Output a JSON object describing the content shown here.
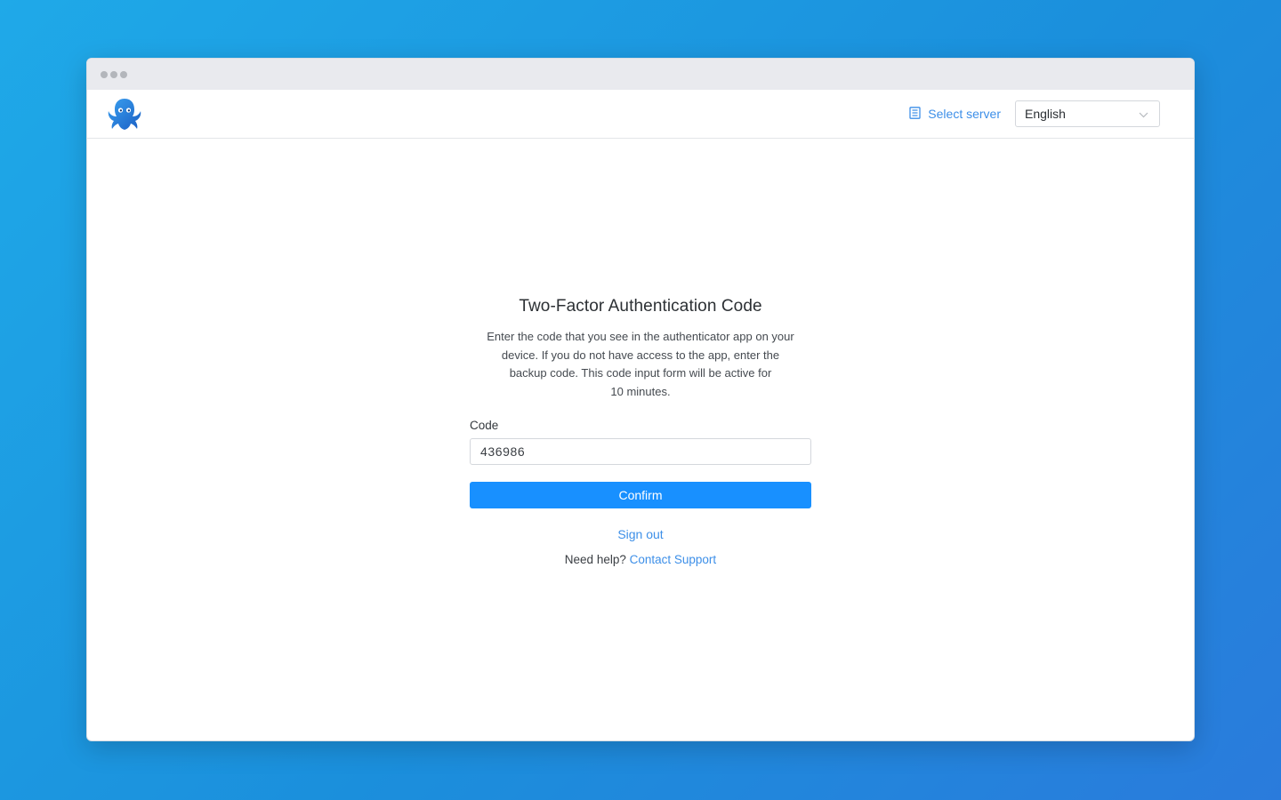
{
  "header": {
    "select_server_label": "Select server",
    "language": {
      "selected": "English"
    }
  },
  "auth": {
    "title": "Two-Factor Authentication Code",
    "description_lines": [
      "Enter the code that you see in the authenticator app on your",
      "device. If you do not have access to the app, enter the",
      "backup code. This code input form will be active for",
      "10 minutes."
    ],
    "code_label": "Code",
    "code_value": "436986",
    "confirm_label": "Confirm",
    "sign_out_label": "Sign out",
    "help_text": "Need help?",
    "contact_support_label": "Contact Support"
  },
  "colors": {
    "primary": "#1890ff",
    "link": "#3d8fe8",
    "background_gradient_start": "#1fa9e8",
    "background_gradient_end": "#2a7bdc"
  },
  "icons": {
    "logo": "octopus-logo",
    "server": "server-icon",
    "dropdown": "chevron-down-icon"
  }
}
